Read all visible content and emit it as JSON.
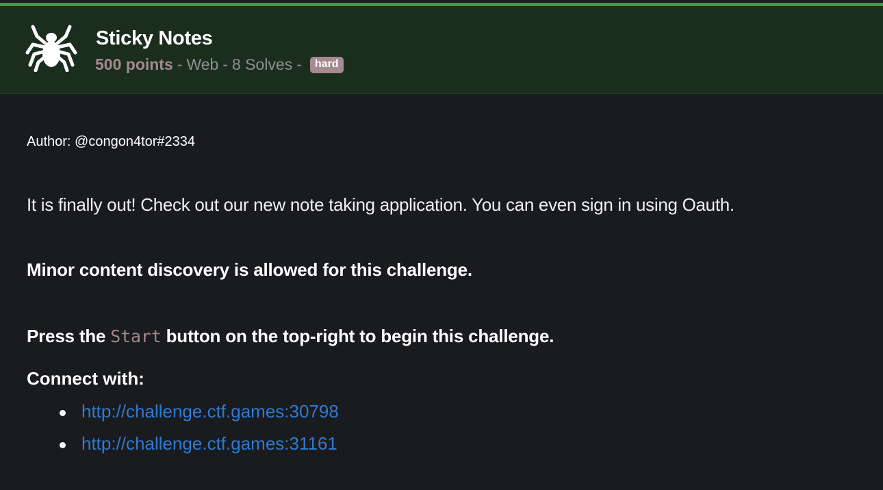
{
  "header": {
    "title": "Sticky Notes",
    "points": "500 points",
    "category": "Web",
    "solves": "8 Solves",
    "difficulty": "hard",
    "separator": "-",
    "icon": "spider-icon",
    "accent_color": "#2fa04a",
    "header_bg": "#1b2e1e"
  },
  "body": {
    "author": "Author: @congon4tor#2334",
    "description": "It is finally out! Check out our new note taking application. You can even sign in using Oauth.",
    "notice": "Minor content discovery is allowed for this challenge.",
    "press_prefix": "Press the",
    "press_code": "Start",
    "press_suffix": "button on the top-right to begin this challenge.",
    "connect_label": "Connect with:",
    "links": [
      {
        "text": "http://challenge.ctf.games:30798"
      },
      {
        "text": "http://challenge.ctf.games:31161"
      }
    ]
  }
}
